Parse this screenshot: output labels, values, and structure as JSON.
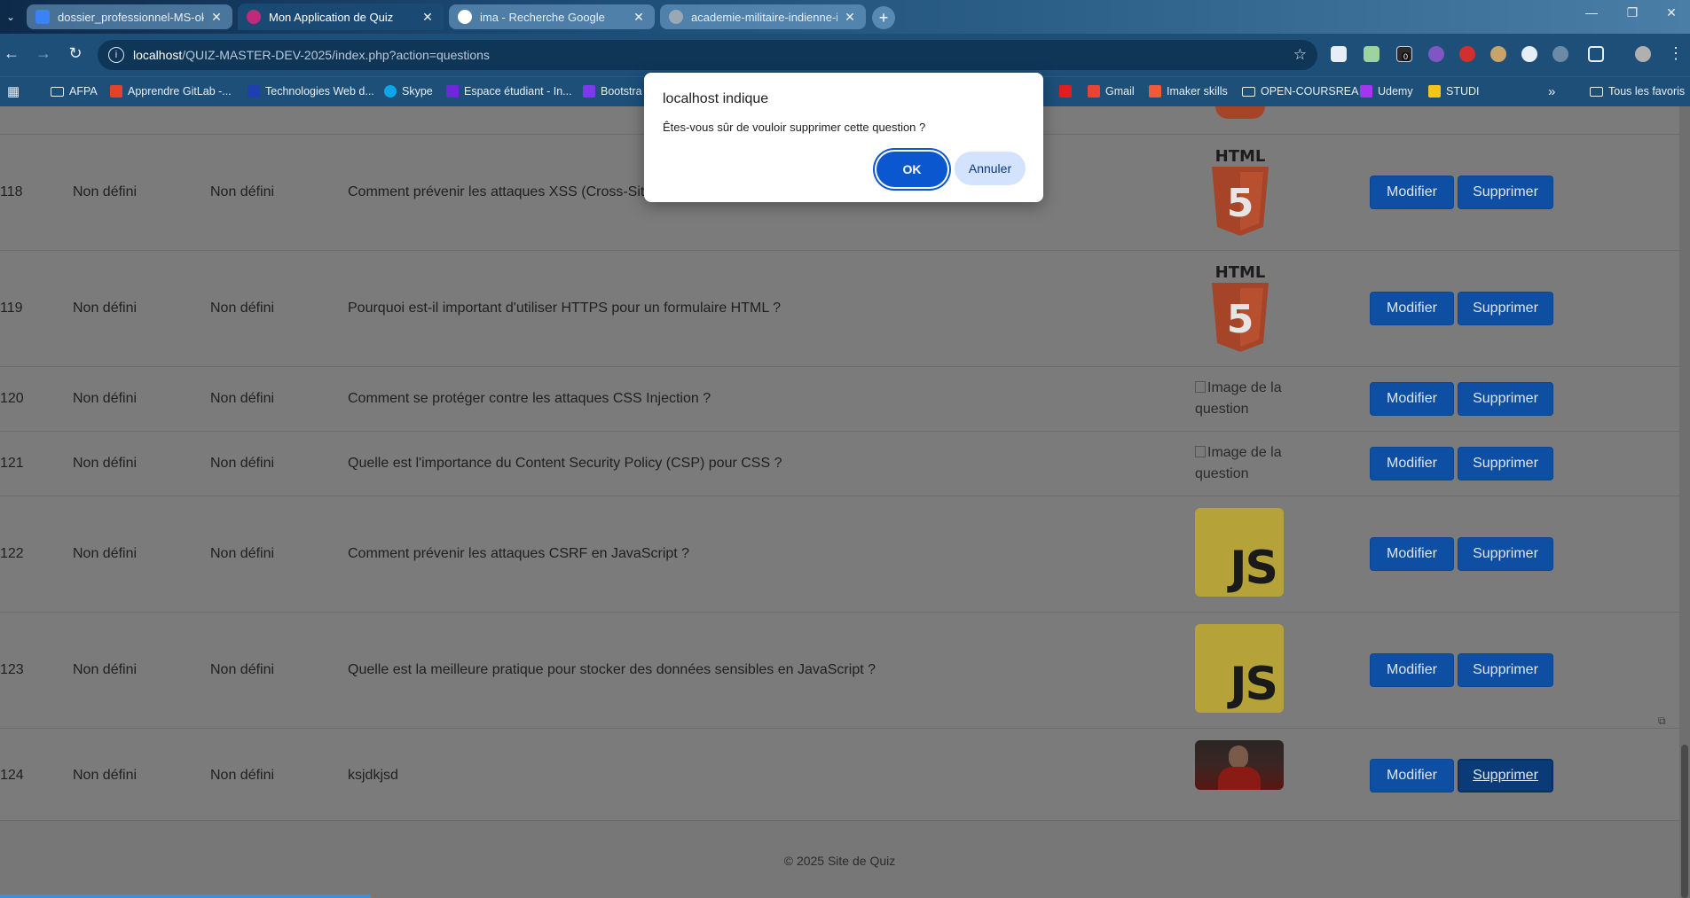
{
  "browser": {
    "tabs": [
      {
        "title": "dossier_professionnel-MS-ok.d",
        "favicon_color": "#3b82f6"
      },
      {
        "title": "Mon Application de Quiz",
        "favicon_color": "#c02a7a"
      },
      {
        "title": "ima - Recherche Google",
        "favicon_color": "#ffffff"
      },
      {
        "title": "academie-militaire-indienne-im",
        "favicon_color": "#9aa7b4"
      }
    ],
    "url_host": "localhost",
    "url_path": "/QUIZ-MASTER-DEV-2025/index.php?action=questions",
    "bookmarks": [
      "AFPA",
      "Apprendre GitLab -...",
      "Technologies Web d...",
      "Skype",
      "Espace étudiant - In...",
      "Bootstra",
      "Gmail",
      "Imaker skills",
      "OPEN-COURSREA",
      "Udemy",
      "STUDI"
    ],
    "all_bookmarks": "Tous les favoris",
    "extension_badge": "0"
  },
  "table": {
    "rows": [
      {
        "id": "118",
        "col2": "Non défini",
        "col3": "Non défini",
        "question": "Comment prévenir les attaques XSS (Cross-Site",
        "image": "html5-logo"
      },
      {
        "id": "119",
        "col2": "Non défini",
        "col3": "Non défini",
        "question": "Pourquoi est-il important d'utiliser HTTPS pour un formulaire HTML ?",
        "image": "html5-logo"
      },
      {
        "id": "120",
        "col2": "Non défini",
        "col3": "Non défini",
        "question": "Comment se protéger contre les attaques CSS Injection ?",
        "image": "broken"
      },
      {
        "id": "121",
        "col2": "Non défini",
        "col3": "Non défini",
        "question": "Quelle est l'importance du Content Security Policy (CSP) pour CSS ?",
        "image": "broken"
      },
      {
        "id": "122",
        "col2": "Non défini",
        "col3": "Non défini",
        "question": "Comment prévenir les attaques CSRF en JavaScript ?",
        "image": "js-logo"
      },
      {
        "id": "123",
        "col2": "Non défini",
        "col3": "Non défini",
        "question": "Quelle est la meilleure pratique pour stocker des données sensibles en JavaScript ?",
        "image": "js-logo"
      },
      {
        "id": "124",
        "col2": "Non défini",
        "col3": "Non défini",
        "question": "ksjdkjsd",
        "image": "photo"
      }
    ],
    "broken_image_alt": "Image de la question",
    "html5_text": "HTML",
    "js_text": "JS",
    "edit_label": "Modifier",
    "delete_label": "Supprimer"
  },
  "footer": {
    "text": "© 2025 Site de Quiz"
  },
  "dialog": {
    "title": "localhost indique",
    "message": "Êtes-vous sûr de vouloir supprimer cette question ?",
    "ok_label": "OK",
    "cancel_label": "Annuler"
  },
  "colors": {
    "primary_button": "#0e4fa3",
    "dialog_ok": "#0b57d0",
    "dialog_cancel": "#d3e3fd"
  }
}
